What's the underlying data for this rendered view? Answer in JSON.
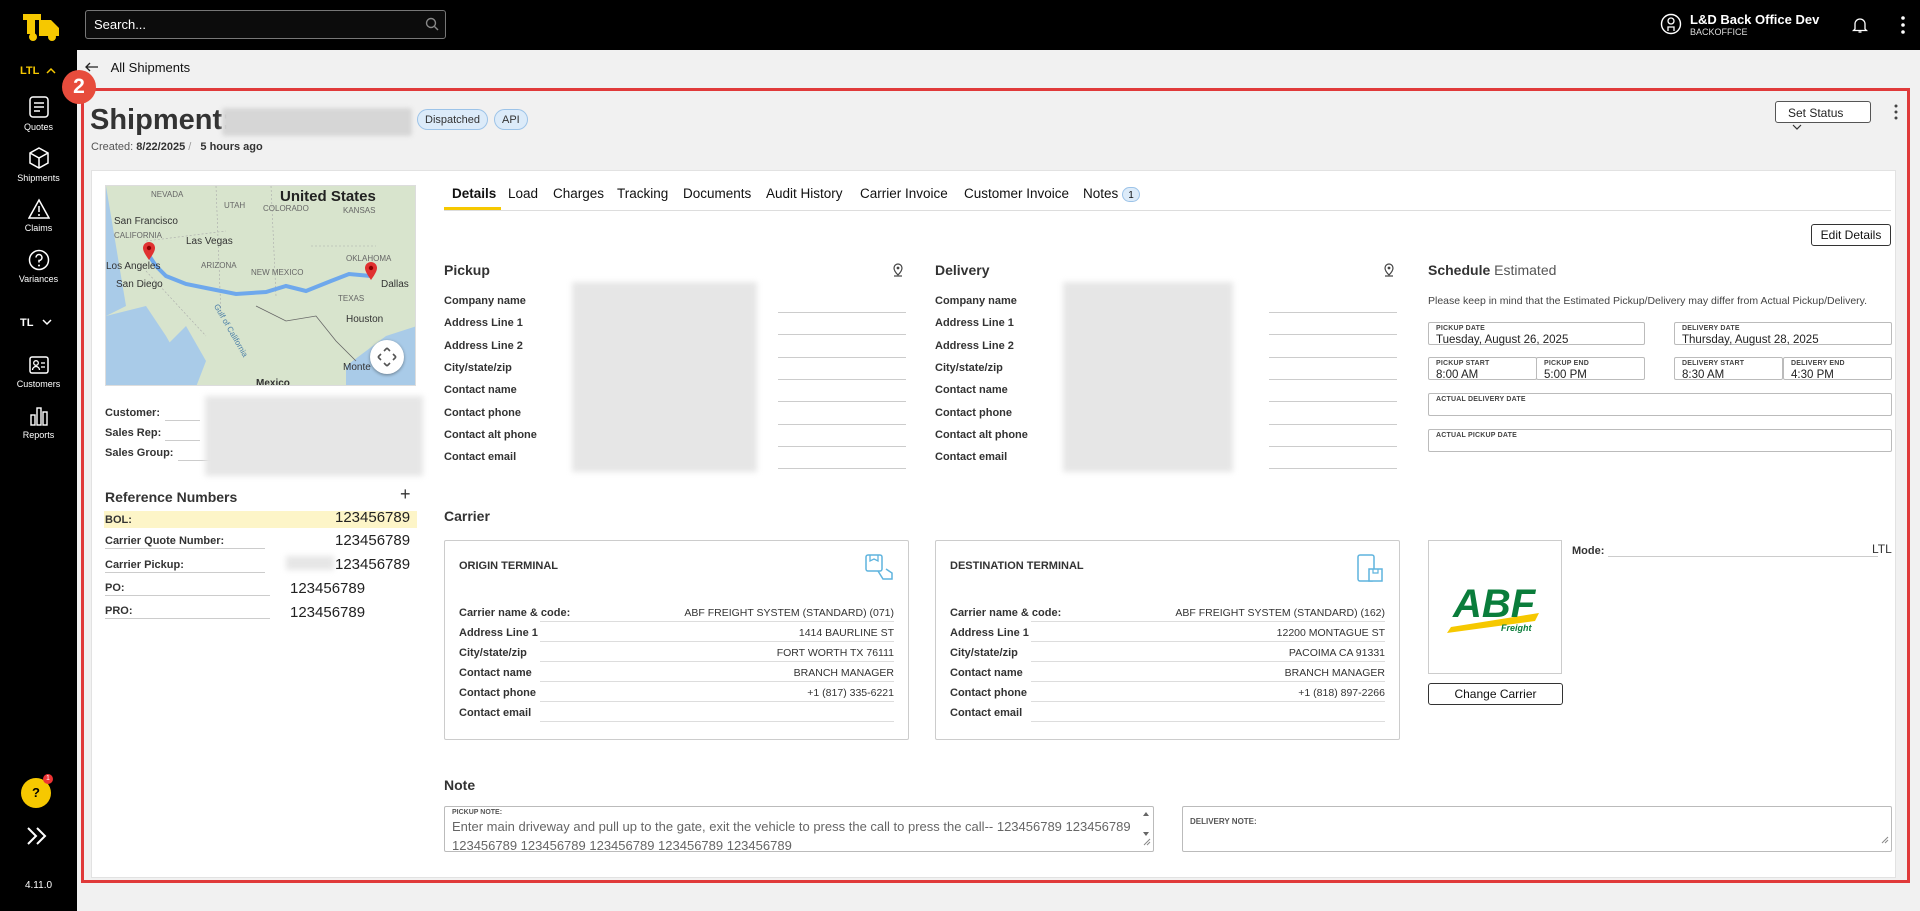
{
  "topbar": {
    "search_placeholder": "Search...",
    "account_name": "L&D Back Office Dev",
    "account_role": "BACKOFFICE"
  },
  "sidebar": {
    "mode_ltl": "LTL",
    "mode_tl": "TL",
    "items": [
      {
        "label": "Quotes",
        "icon": "quotes-icon"
      },
      {
        "label": "Shipments",
        "icon": "box-icon"
      },
      {
        "label": "Claims",
        "icon": "warning-icon"
      },
      {
        "label": "Variances",
        "icon": "question-circle-icon"
      },
      {
        "label": "Customers",
        "icon": "id-card-icon"
      },
      {
        "label": "Reports",
        "icon": "bar-chart-icon"
      }
    ],
    "help_label": "?",
    "help_badge": "1",
    "version": "4.11.0"
  },
  "back_link": "All Shipments",
  "annotation_number": "2",
  "shipment": {
    "title": "Shipment:",
    "status_pill": "Dispatched",
    "source_pill": "API",
    "created_label": "Created:",
    "created_date": "8/22/2025",
    "created_sep": "/",
    "created_ago": "5 hours ago",
    "set_status": "Set Status"
  },
  "map": {
    "title": "United States",
    "labels": [
      "San Francisco",
      "Las Vegas",
      "Los Angeles",
      "San Diego",
      "Dallas",
      "Houston",
      "Monte",
      "Mexico"
    ],
    "region_labels": [
      "NEVADA",
      "UTAH",
      "COLORADO",
      "KANSAS",
      "CALIFORNIA",
      "ARIZONA",
      "NEW MEXICO",
      "OKLAHOMA",
      "TEXAS",
      "Gulf of California"
    ],
    "route_color": "#6ea8ec",
    "pin_color": "#e03131"
  },
  "customer_info": {
    "customer": "Customer:",
    "sales_rep": "Sales Rep:",
    "sales_group": "Sales Group:"
  },
  "references": {
    "title": "Reference Numbers",
    "add": "+",
    "rows": [
      {
        "label": "BOL:",
        "value": "123456789"
      },
      {
        "label": "Carrier Quote Number:",
        "value": "123456789"
      },
      {
        "label": "Carrier Pickup:",
        "value": "123456789"
      },
      {
        "label": "PO:",
        "value": "123456789"
      },
      {
        "label": "PRO:",
        "value": "123456789"
      }
    ]
  },
  "tabs": [
    {
      "label": "Details"
    },
    {
      "label": "Load"
    },
    {
      "label": "Charges"
    },
    {
      "label": "Tracking"
    },
    {
      "label": "Documents"
    },
    {
      "label": "Audit History"
    },
    {
      "label": "Carrier Invoice"
    },
    {
      "label": "Customer Invoice"
    },
    {
      "label": "Notes",
      "count": "1"
    }
  ],
  "edit_details": "Edit Details",
  "pickup": {
    "title": "Pickup",
    "fields": [
      "Company name",
      "Address Line 1",
      "Address Line 2",
      "City/state/zip",
      "Contact name",
      "Contact phone",
      "Contact alt phone",
      "Contact email"
    ]
  },
  "delivery": {
    "title": "Delivery",
    "fields": [
      "Company name",
      "Address Line 1",
      "Address Line 2",
      "City/state/zip",
      "Contact name",
      "Contact phone",
      "Contact alt phone",
      "Contact email"
    ]
  },
  "schedule": {
    "title": "Schedule",
    "subtitle": "Estimated",
    "note": "Please keep in mind that the Estimated Pickup/Delivery may differ from Actual Pickup/Delivery.",
    "pickup_date_label": "PICKUP DATE",
    "pickup_date": "Tuesday, August 26, 2025",
    "delivery_date_label": "DELIVERY DATE",
    "delivery_date": "Thursday, August 28, 2025",
    "pickup_start_label": "PICKUP START",
    "pickup_start": "8:00 AM",
    "pickup_end_label": "PICKUP END",
    "pickup_end": "5:00 PM",
    "delivery_start_label": "DELIVERY START",
    "delivery_start": "8:30 AM",
    "delivery_end_label": "DELIVERY END",
    "delivery_end": "4:30 PM",
    "actual_delivery_label": "ACTUAL DELIVERY DATE",
    "actual_pickup_label": "ACTUAL PICKUP DATE"
  },
  "carrier": {
    "title": "Carrier",
    "origin": {
      "title": "ORIGIN TERMINAL",
      "rows": [
        {
          "label": "Carrier name & code:",
          "value": "ABF FREIGHT SYSTEM (STANDARD) (071)"
        },
        {
          "label": "Address Line 1",
          "value": "1414 BAURLINE ST"
        },
        {
          "label": "City/state/zip",
          "value": "FORT WORTH TX 76111"
        },
        {
          "label": "Contact name",
          "value": "BRANCH MANAGER"
        },
        {
          "label": "Contact phone",
          "value": "+1 (817) 335-6221"
        },
        {
          "label": "Contact email",
          "value": ""
        }
      ]
    },
    "destination": {
      "title": "DESTINATION TERMINAL",
      "rows": [
        {
          "label": "Carrier name & code:",
          "value": "ABF FREIGHT SYSTEM (STANDARD) (162)"
        },
        {
          "label": "Address Line 1",
          "value": "12200 MONTAGUE ST"
        },
        {
          "label": "City/state/zip",
          "value": "PACOIMA CA 91331"
        },
        {
          "label": "Contact name",
          "value": "BRANCH MANAGER"
        },
        {
          "label": "Contact phone",
          "value": "+1 (818) 897-2266"
        },
        {
          "label": "Contact email",
          "value": ""
        }
      ]
    },
    "logo_text": "ABF",
    "logo_sub": "Freight",
    "change_carrier": "Change Carrier",
    "mode_label": "Mode:",
    "mode_value": "LTL"
  },
  "note": {
    "title": "Note",
    "pickup_label": "PICKUP NOTE:",
    "pickup_text": "Enter main driveway and pull up to the gate, exit the vehicle to press the call to press the call-- 123456789 123456789 123456789 123456789 123456789 123456789 123456789",
    "delivery_label": "DELIVERY NOTE:"
  },
  "colors": {
    "accent": "#f6c800",
    "highlight_frame": "#e03a3a",
    "pill_bg": "#dcebf9",
    "abf_green": "#0a7d3b",
    "abf_yellow": "#f6c800"
  }
}
